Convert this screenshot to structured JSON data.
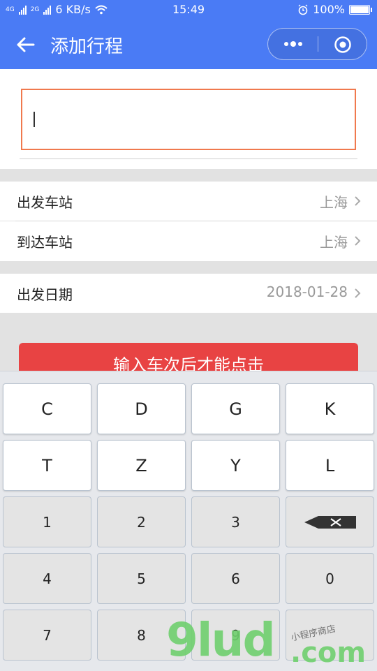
{
  "status_bar": {
    "network_1": "4G",
    "network_2": "2G",
    "speed": "6 KB/s",
    "time": "15:49",
    "battery": "100%"
  },
  "nav": {
    "title": "添加行程",
    "back_icon": "arrow-left-icon",
    "more_icon": "more-dots-icon",
    "close_icon": "target-circle-icon"
  },
  "train_input": {
    "value": ""
  },
  "rows": {
    "departure": {
      "label": "出发车站",
      "value": "上海"
    },
    "arrival": {
      "label": "到达车站",
      "value": "上海"
    },
    "date": {
      "label": "出发日期",
      "value": "2018-01-28"
    }
  },
  "submit": {
    "label": "输入车次后才能点击"
  },
  "keyboard": {
    "row1": [
      "C",
      "D",
      "G",
      "K"
    ],
    "row2": [
      "T",
      "Z",
      "Y",
      "L"
    ],
    "row3": [
      "1",
      "2",
      "3"
    ],
    "row4": [
      "4",
      "5",
      "6",
      "0"
    ],
    "row5": [
      "7",
      "8",
      "9"
    ],
    "delete_icon": "backspace-icon"
  },
  "watermark": {
    "text": "9lud",
    "suffix": ".com",
    "small": "小程序商店"
  },
  "colors": {
    "brand_blue": "#4a7bf5",
    "accent_orange": "#f0794e",
    "button_red": "#e84343"
  }
}
